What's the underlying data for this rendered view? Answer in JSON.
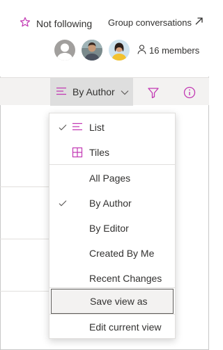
{
  "header": {
    "follow_label": "Not following",
    "group_conversations_label": "Group conversations",
    "members_label": "16 members"
  },
  "commandbar": {
    "view_label": "By Author"
  },
  "menu": {
    "layout_items": [
      {
        "label": "List",
        "checked": true,
        "icon": "list-icon"
      },
      {
        "label": "Tiles",
        "checked": false,
        "icon": "tiles-icon"
      }
    ],
    "view_items": [
      {
        "label": "All Pages",
        "checked": false
      },
      {
        "label": "By Author",
        "checked": true
      },
      {
        "label": "By Editor",
        "checked": false
      },
      {
        "label": "Created By Me",
        "checked": false
      },
      {
        "label": "Recent Changes",
        "checked": false
      }
    ],
    "save_view_label": "Save view as",
    "edit_view_label": "Edit current view"
  },
  "colors": {
    "accent": "#c239b3",
    "text": "#323130",
    "check": "#605e5c"
  }
}
